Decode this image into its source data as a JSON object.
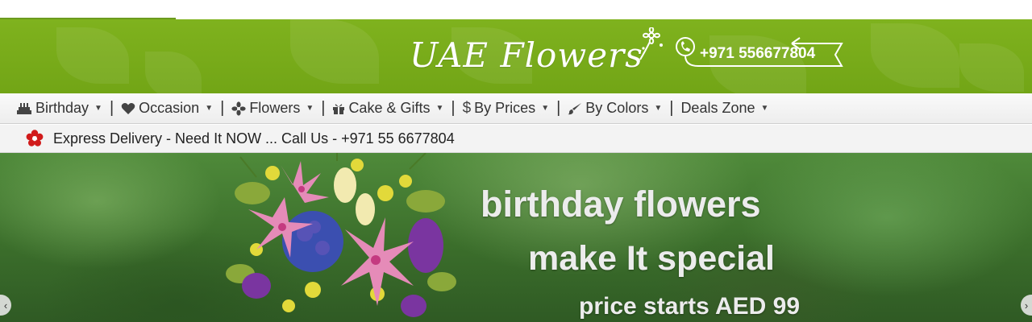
{
  "header": {
    "logo_text": "UAE Flowers",
    "phone": "+971 556677804"
  },
  "nav": {
    "items": [
      {
        "label": "Birthday",
        "icon": "cake-icon"
      },
      {
        "label": "Occasion",
        "icon": "heart-icon"
      },
      {
        "label": "Flowers",
        "icon": "flower-icon"
      },
      {
        "label": "Cake & Gifts",
        "icon": "gift-icon"
      },
      {
        "label": "By Prices",
        "icon": "dollar-icon"
      },
      {
        "label": "By Colors",
        "icon": "brush-icon"
      },
      {
        "label": "Deals Zone",
        "icon": ""
      }
    ]
  },
  "express": {
    "text": "Express Delivery - Need It NOW ... Call Us - +971 55 6677804",
    "icon": "red-flower-icon"
  },
  "hero": {
    "line1": "birthday flowers",
    "line2": "make It special",
    "line3": "price starts AED 99"
  },
  "colors": {
    "brand_green": "#7fb21e",
    "express_icon_red": "#d11a1a"
  }
}
